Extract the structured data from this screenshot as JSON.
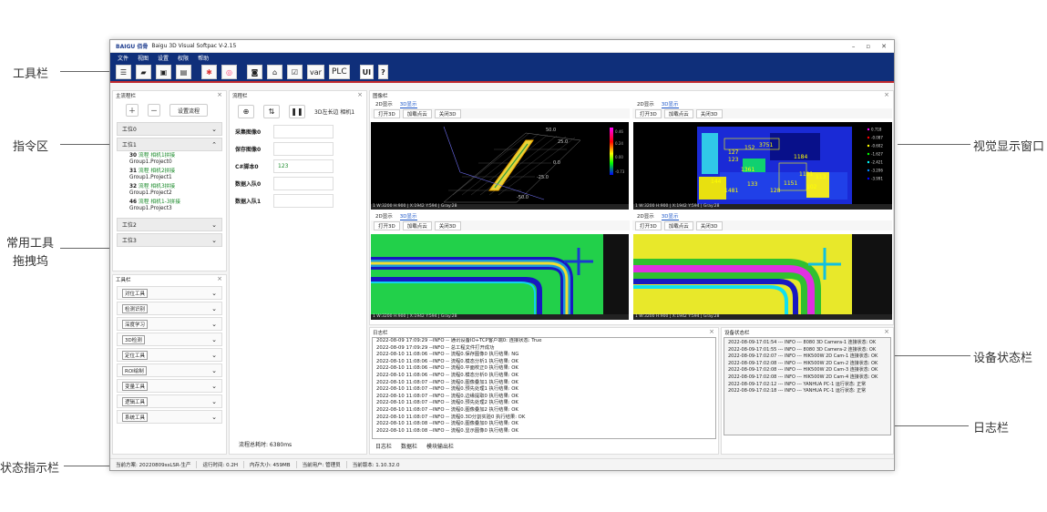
{
  "callouts": {
    "toolbar": "工具栏",
    "command_area": "指令区",
    "common_tools_1": "常用工具",
    "common_tools_2": "拖拽坞",
    "status_indicator": "状态指示栏",
    "visual_display": "视觉显示窗口",
    "device_status": "设备状态栏",
    "log_bar": "日志栏"
  },
  "window": {
    "brand": "BAIGU 佰骨",
    "title": "Baigu 3D Visual Softpac V-2.15",
    "controls": [
      "–",
      "▫",
      "✕"
    ]
  },
  "menu": [
    "文件",
    "视图",
    "设置",
    "权限",
    "帮助"
  ],
  "toolbar": {
    "icons": [
      "list-icon",
      "open-folder-icon",
      "save-icon",
      "device-icon",
      "tool-red-icon",
      "target-icon",
      "camera-icon",
      "house-camera-icon",
      "checklist-icon",
      "var-icon",
      "plc-icon",
      "ui-icon",
      "help-icon"
    ],
    "var_label": "var",
    "plc_label": "PLC",
    "ui_label": "UI",
    "help_label": "?"
  },
  "main_flow": {
    "title": "主流程栏",
    "set_flow": "设置流程",
    "stations": [
      {
        "label": "工位0",
        "expanded": false
      },
      {
        "label": "工位1",
        "expanded": true,
        "items": [
          {
            "num": "30",
            "name": "流程 相机1拼接",
            "sub": "Group1.Project0"
          },
          {
            "num": "31",
            "name": "流程 相机2拼接",
            "sub": "Group1.Project1"
          },
          {
            "num": "32",
            "name": "流程 相机3拼接",
            "sub": "Group1.Project2"
          },
          {
            "num": "46",
            "name": "流程 相机1-3拼接",
            "sub": "Group1.Project3"
          }
        ]
      },
      {
        "label": "工位2",
        "expanded": false
      },
      {
        "label": "工位3",
        "expanded": false
      }
    ]
  },
  "toolbox": {
    "title": "工具栏",
    "items": [
      "对位工具",
      "检测识别",
      "深度学习",
      "3D检测",
      "定位工具",
      "ROI绘制",
      "变量工具",
      "逻辑工具",
      "系统工具"
    ]
  },
  "flow_panel": {
    "title": "流程栏",
    "flow_name": "3D左长边 相机1",
    "fields": [
      {
        "label": "采集图像0",
        "value": ""
      },
      {
        "label": "保存图像0",
        "value": ""
      },
      {
        "label": "C#脚本0",
        "value": "123"
      },
      {
        "label": "数据入队0",
        "value": ""
      },
      {
        "label": "数据入队1",
        "value": ""
      }
    ],
    "total_time": "流程总耗时: 6380ms"
  },
  "image_panel": {
    "title": "图像栏",
    "tabs": [
      "2D显示",
      "3D显示"
    ],
    "buttons": [
      "打开3D",
      "加载点云",
      "关闭3D"
    ],
    "info": "1  W:3200 H:900 | X:1942 Y:594 | Gray:28",
    "axis_labels": [
      "50.0",
      "25.0",
      "0.0",
      "-25.0",
      "-50.0"
    ],
    "colorbar_ticks": [
      "0.46",
      "0.24",
      "0.00",
      "-0.73"
    ],
    "legend": [
      "0.718",
      "-0.087",
      "-0.602",
      "-1.627",
      "-2.421",
      "-3.206",
      "-3.991"
    ],
    "overlay_numbers": [
      "152",
      "3751",
      "127",
      "123",
      "1361",
      "144",
      "1481",
      "133",
      "128",
      "1101",
      "113",
      "1151",
      "102",
      "1184"
    ]
  },
  "log_panel": {
    "title": "日志栏",
    "lines": [
      "2022-08-09 17:09:29 --INFO -- 通讯设备IO+TCP客户端0: 连接状态: True",
      "2022-08-09 17:09:29 --INFO -- 总工程文件打开成功",
      "2022-08-10 11:08:06 --INFO -- 流程0.保存图像0 执行结果: NG",
      "2022-08-10 11:08:06 --INFO -- 流程0.模态分析1 执行结果: OK",
      "2022-08-10 11:08:06 --INFO -- 流程0.平面校正0 执行结果: OK",
      "2022-08-10 11:08:06 --INFO -- 流程0.模态分析0 执行结果: OK",
      "2022-08-10 11:08:07 --INFO -- 流程0.图像叠加1 执行结果: OK",
      "2022-08-10 11:08:07 --INFO -- 流程0.预先处理1 执行结果: OK",
      "2022-08-10 11:08:07 --INFO -- 流程0.边缘提取0 执行结果: OK",
      "2022-08-10 11:08:07 --INFO -- 流程0.预先处理2 执行结果: OK",
      "2022-08-10 11:08:07 --INFO -- 流程0.图像叠加2 执行结果: OK",
      "2022-08-10 11:08:07 --INFO -- 流程0.3D分割实验0 执行结果: OK",
      "2022-08-10 11:08:08 --INFO -- 流程0.图像叠加0 执行结果: OK",
      "2022-08-10 11:08:08 --INFO -- 流程0.显示图像0 执行结果: OK"
    ],
    "tabs": [
      "日志栏",
      "数据栏",
      "模块输出栏"
    ]
  },
  "device_panel": {
    "title": "设备状态栏",
    "lines": [
      "2022-08-09-17:01:54 --- INFO --- 8080 3D Camera-1 连接状态: OK",
      "2022-08-09-17:01:55 --- INFO --- 8080 3D Camera-2 连接状态: OK",
      "2022-08-09-17:02:07 --- INFO --- HIK500W 2D Cam-1 连接状态: OK",
      "2022-08-09-17:02:08 --- INFO --- HIK500W 2D Cam-2 连接状态: OK",
      "2022-08-09-17:02:08 --- INFO --- HIK500W 2D Cam-3 连接状态: OK",
      "2022-08-09-17:02:08 --- INFO --- HIK500W 2D Cam-4 连接状态: OK",
      "2022-08-09-17:02:12 --- INFO --- YANHUA PC-1 运行状态: 正常",
      "2022-08-09-17:02:18 --- INFO --- YANHUA PC-1 运行状态: 正常"
    ]
  },
  "statusbar": {
    "plan": "当前方案: 20220809ssLSR-生产",
    "runtime": "运行时间: 0.2H",
    "memory": "内存大小: 459MB",
    "user": "当前用户: 管理员",
    "version": "当前版本: 1.10.32.0"
  },
  "colors": {
    "nav_blue": "#0f2f7a",
    "accent_red": "#c0282d",
    "ok_green": "#1a8a2a",
    "tab_blue": "#1a55c8"
  }
}
